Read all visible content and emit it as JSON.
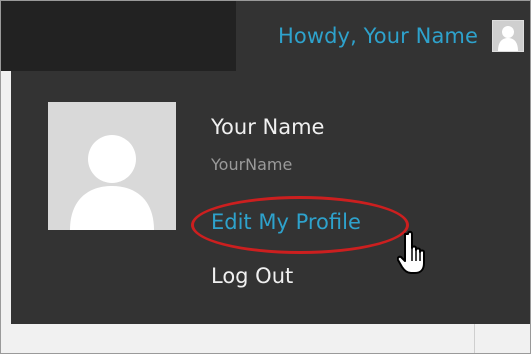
{
  "adminbar": {
    "greeting": "Howdy, Your Name"
  },
  "account_menu": {
    "display_name": "Your Name",
    "username": "YourName",
    "edit_profile_label": "Edit My Profile",
    "logout_label": "Log Out"
  },
  "icons": {
    "small_avatar": "user-avatar-icon",
    "large_avatar": "user-avatar-icon",
    "cursor": "hand-pointer-icon"
  },
  "colors": {
    "adminbar_dark": "#222222",
    "menu_background": "#333333",
    "link_blue": "#2ea2cc",
    "highlight_red": "#cc1f1f",
    "avatar_gray": "#d9d9d9"
  }
}
